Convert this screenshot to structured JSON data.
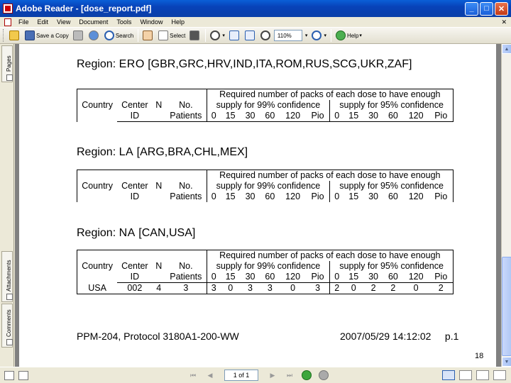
{
  "window": {
    "title": "Adobe Reader - [dose_report.pdf]",
    "minimize": "_",
    "maximize": "□",
    "close": "✕"
  },
  "menu": {
    "items": [
      "File",
      "Edit",
      "View",
      "Document",
      "Tools",
      "Window",
      "Help"
    ],
    "doc_close": "✕"
  },
  "toolbar": {
    "save_copy": "Save a Copy",
    "search": "Search",
    "select": "Select",
    "zoom_value": "110%",
    "help": "Help",
    "icons": [
      "open-icon",
      "save-icon",
      "print-icon",
      "email-icon",
      "search-icon",
      "hand-icon",
      "select-icon",
      "snapshot-icon",
      "zoom-icon",
      "fit-width-icon",
      "zoom-out-icon",
      "rotate-icon",
      "help-icon"
    ]
  },
  "nav_tabs": {
    "pages": "Pages",
    "attachments": "Attachments",
    "comments": "Comments"
  },
  "document": {
    "regions": [
      {
        "label": "Region:",
        "code": "ERO",
        "countries": "[GBR,GRC,HRV,IND,ITA,ROM,RUS,SCG,UKR,ZAF]",
        "rows": []
      },
      {
        "label": "Region:",
        "code": "LA",
        "countries": "[ARG,BRA,CHL,MEX]",
        "rows": []
      },
      {
        "label": "Region:",
        "code": "NA",
        "countries": "[CAN,USA]",
        "rows": [
          {
            "country": "USA",
            "center": "002",
            "n": "4",
            "patients": "3",
            "c99": [
              "3",
              "0",
              "3",
              "3",
              "0",
              "3"
            ],
            "c95": [
              "2",
              "0",
              "2",
              "2",
              "0",
              "2"
            ]
          }
        ]
      }
    ],
    "table_header": {
      "country": "Country",
      "center_1": "Center",
      "center_2": "ID",
      "n": "N",
      "no_1": "No.",
      "no_2": "Patients",
      "required": "Required number of packs of each dose to have enough",
      "supply99": "supply for 99% confidence",
      "supply95": "supply for 95% confidence",
      "doses": [
        "0",
        "15",
        "30",
        "60",
        "120",
        "Pio"
      ]
    },
    "footer_left": "PPM-204, Protocol 3180A1-200-WW",
    "footer_date": "2007/05/29 14:12:02",
    "footer_page": "p.1",
    "slide_number": "18"
  },
  "statusbar": {
    "page_field": "1 of 1"
  }
}
